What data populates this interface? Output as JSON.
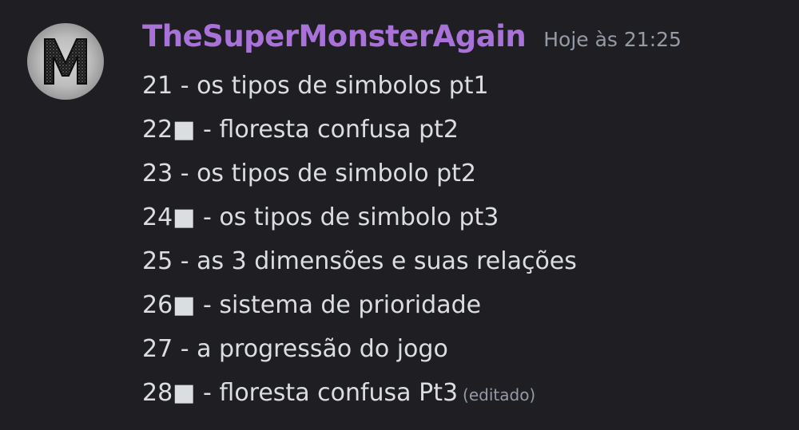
{
  "author": {
    "username": "TheSuperMonsterAgain",
    "avatar_letter": "M",
    "name_color": "#a872d8"
  },
  "message": {
    "timestamp": "Hoje às 21:25",
    "edited_label": "(editado)",
    "lines": [
      "21 - os tipos de simbolos pt1",
      "22■ - floresta confusa pt2",
      "23 - os tipos de simbolo pt2",
      "24■ - os tipos de simbolo pt3",
      "25 - as 3 dimensões e suas relações",
      "26■ - sistema de prioridade",
      "27 - a progressão do jogo",
      "28■ - floresta confusa Pt3"
    ]
  }
}
